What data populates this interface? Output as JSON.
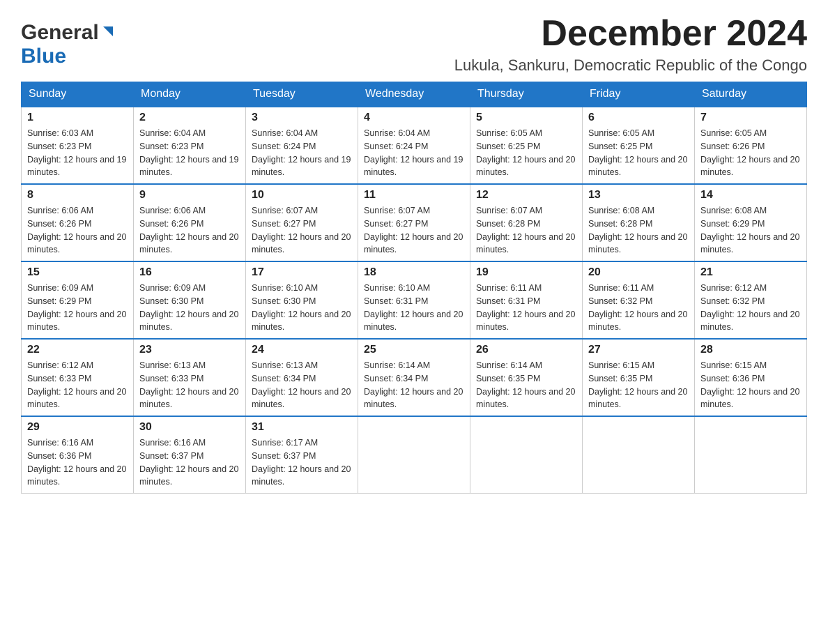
{
  "header": {
    "logo_general": "General",
    "logo_blue": "Blue",
    "month_title": "December 2024",
    "location": "Lukula, Sankuru, Democratic Republic of the Congo"
  },
  "weekdays": [
    "Sunday",
    "Monday",
    "Tuesday",
    "Wednesday",
    "Thursday",
    "Friday",
    "Saturday"
  ],
  "weeks": [
    [
      {
        "day": "1",
        "sunrise": "6:03 AM",
        "sunset": "6:23 PM",
        "daylight": "12 hours and 19 minutes."
      },
      {
        "day": "2",
        "sunrise": "6:04 AM",
        "sunset": "6:23 PM",
        "daylight": "12 hours and 19 minutes."
      },
      {
        "day": "3",
        "sunrise": "6:04 AM",
        "sunset": "6:24 PM",
        "daylight": "12 hours and 19 minutes."
      },
      {
        "day": "4",
        "sunrise": "6:04 AM",
        "sunset": "6:24 PM",
        "daylight": "12 hours and 19 minutes."
      },
      {
        "day": "5",
        "sunrise": "6:05 AM",
        "sunset": "6:25 PM",
        "daylight": "12 hours and 20 minutes."
      },
      {
        "day": "6",
        "sunrise": "6:05 AM",
        "sunset": "6:25 PM",
        "daylight": "12 hours and 20 minutes."
      },
      {
        "day": "7",
        "sunrise": "6:05 AM",
        "sunset": "6:26 PM",
        "daylight": "12 hours and 20 minutes."
      }
    ],
    [
      {
        "day": "8",
        "sunrise": "6:06 AM",
        "sunset": "6:26 PM",
        "daylight": "12 hours and 20 minutes."
      },
      {
        "day": "9",
        "sunrise": "6:06 AM",
        "sunset": "6:26 PM",
        "daylight": "12 hours and 20 minutes."
      },
      {
        "day": "10",
        "sunrise": "6:07 AM",
        "sunset": "6:27 PM",
        "daylight": "12 hours and 20 minutes."
      },
      {
        "day": "11",
        "sunrise": "6:07 AM",
        "sunset": "6:27 PM",
        "daylight": "12 hours and 20 minutes."
      },
      {
        "day": "12",
        "sunrise": "6:07 AM",
        "sunset": "6:28 PM",
        "daylight": "12 hours and 20 minutes."
      },
      {
        "day": "13",
        "sunrise": "6:08 AM",
        "sunset": "6:28 PM",
        "daylight": "12 hours and 20 minutes."
      },
      {
        "day": "14",
        "sunrise": "6:08 AM",
        "sunset": "6:29 PM",
        "daylight": "12 hours and 20 minutes."
      }
    ],
    [
      {
        "day": "15",
        "sunrise": "6:09 AM",
        "sunset": "6:29 PM",
        "daylight": "12 hours and 20 minutes."
      },
      {
        "day": "16",
        "sunrise": "6:09 AM",
        "sunset": "6:30 PM",
        "daylight": "12 hours and 20 minutes."
      },
      {
        "day": "17",
        "sunrise": "6:10 AM",
        "sunset": "6:30 PM",
        "daylight": "12 hours and 20 minutes."
      },
      {
        "day": "18",
        "sunrise": "6:10 AM",
        "sunset": "6:31 PM",
        "daylight": "12 hours and 20 minutes."
      },
      {
        "day": "19",
        "sunrise": "6:11 AM",
        "sunset": "6:31 PM",
        "daylight": "12 hours and 20 minutes."
      },
      {
        "day": "20",
        "sunrise": "6:11 AM",
        "sunset": "6:32 PM",
        "daylight": "12 hours and 20 minutes."
      },
      {
        "day": "21",
        "sunrise": "6:12 AM",
        "sunset": "6:32 PM",
        "daylight": "12 hours and 20 minutes."
      }
    ],
    [
      {
        "day": "22",
        "sunrise": "6:12 AM",
        "sunset": "6:33 PM",
        "daylight": "12 hours and 20 minutes."
      },
      {
        "day": "23",
        "sunrise": "6:13 AM",
        "sunset": "6:33 PM",
        "daylight": "12 hours and 20 minutes."
      },
      {
        "day": "24",
        "sunrise": "6:13 AM",
        "sunset": "6:34 PM",
        "daylight": "12 hours and 20 minutes."
      },
      {
        "day": "25",
        "sunrise": "6:14 AM",
        "sunset": "6:34 PM",
        "daylight": "12 hours and 20 minutes."
      },
      {
        "day": "26",
        "sunrise": "6:14 AM",
        "sunset": "6:35 PM",
        "daylight": "12 hours and 20 minutes."
      },
      {
        "day": "27",
        "sunrise": "6:15 AM",
        "sunset": "6:35 PM",
        "daylight": "12 hours and 20 minutes."
      },
      {
        "day": "28",
        "sunrise": "6:15 AM",
        "sunset": "6:36 PM",
        "daylight": "12 hours and 20 minutes."
      }
    ],
    [
      {
        "day": "29",
        "sunrise": "6:16 AM",
        "sunset": "6:36 PM",
        "daylight": "12 hours and 20 minutes."
      },
      {
        "day": "30",
        "sunrise": "6:16 AM",
        "sunset": "6:37 PM",
        "daylight": "12 hours and 20 minutes."
      },
      {
        "day": "31",
        "sunrise": "6:17 AM",
        "sunset": "6:37 PM",
        "daylight": "12 hours and 20 minutes."
      },
      null,
      null,
      null,
      null
    ]
  ]
}
